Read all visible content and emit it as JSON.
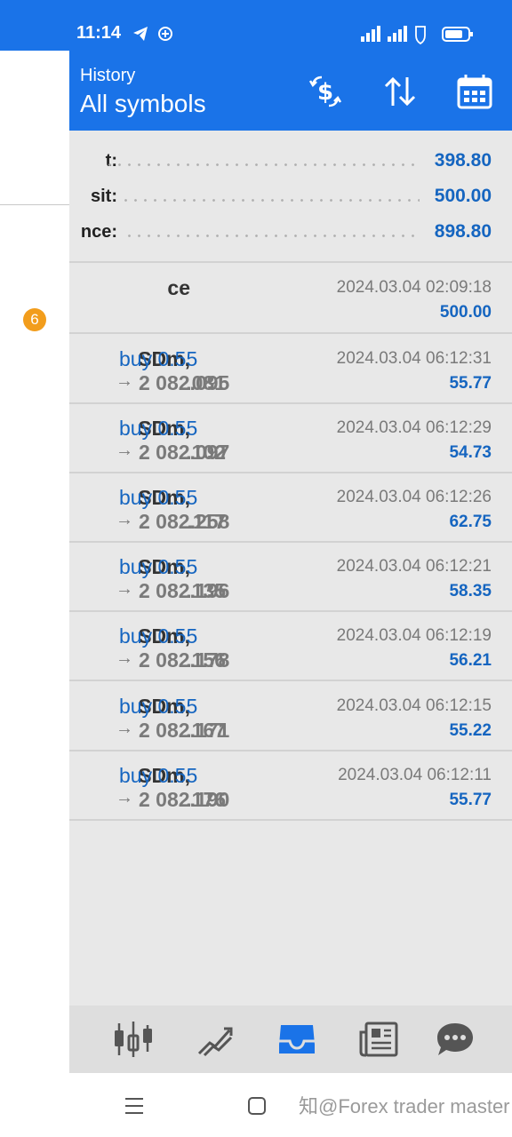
{
  "status_bar": {
    "time": "11:14"
  },
  "header": {
    "subtitle": "History",
    "title": "All symbols"
  },
  "drawer": {
    "badge_count": "6"
  },
  "summary": [
    {
      "label": "t:",
      "value": "398.80"
    },
    {
      "label": "sit:",
      "value": "500.00"
    },
    {
      "label": "nce:",
      "value": "898.80"
    }
  ],
  "balance_entry": {
    "label": "ce",
    "time": "2024.03.04 02:09:18",
    "amount": "500.00"
  },
  "deals": [
    {
      "symbol": "SDm,",
      "side": "buy 0.55",
      "open_price": ".081",
      "arrow": "→",
      "close_price": "2 082.095",
      "time": "2024.03.04 06:12:31",
      "profit": "55.77"
    },
    {
      "symbol": "SDm,",
      "side": "buy 0.55",
      "open_price": ".102",
      "arrow": "→",
      "close_price": "2 082.097",
      "time": "2024.03.04 06:12:29",
      "profit": "54.73"
    },
    {
      "symbol": "SDm,",
      "side": "buy 0.55",
      "open_price": ".117",
      "arrow": "→",
      "close_price": "2 082.258",
      "time": "2024.03.04 06:12:26",
      "profit": "62.75"
    },
    {
      "symbol": "SDm,",
      "side": "buy 0.55",
      "open_price": ".135",
      "arrow": "→",
      "close_price": "2 082.196",
      "time": "2024.03.04 06:12:21",
      "profit": "58.35"
    },
    {
      "symbol": "SDm,",
      "side": "buy 0.55",
      "open_price": ".156",
      "arrow": "→",
      "close_price": "2 082.178",
      "time": "2024.03.04 06:12:19",
      "profit": "56.21"
    },
    {
      "symbol": "SDm,",
      "side": "buy 0.55",
      "open_price": ".167",
      "arrow": "→",
      "close_price": "2 082.171",
      "time": "2024.03.04 06:12:15",
      "profit": "55.22"
    },
    {
      "symbol": "SDm,",
      "side": "buy 0.55",
      "open_price": ".176",
      "arrow": "→",
      "close_price": "2 082.190",
      "time": "2024.03.04 06:12:11",
      "profit": "55.77"
    }
  ],
  "bottom_nav": [
    {
      "icon": "quotes-icon"
    },
    {
      "icon": "chart-icon"
    },
    {
      "icon": "trade-inbox-icon",
      "active": true
    },
    {
      "icon": "news-icon"
    },
    {
      "icon": "chat-icon"
    }
  ],
  "watermark": "知@Forex trader master",
  "colors": {
    "accent": "#1a73e8",
    "value_blue": "#1565c0",
    "badge": "#f29d1c",
    "background": "#e8e8e8"
  }
}
